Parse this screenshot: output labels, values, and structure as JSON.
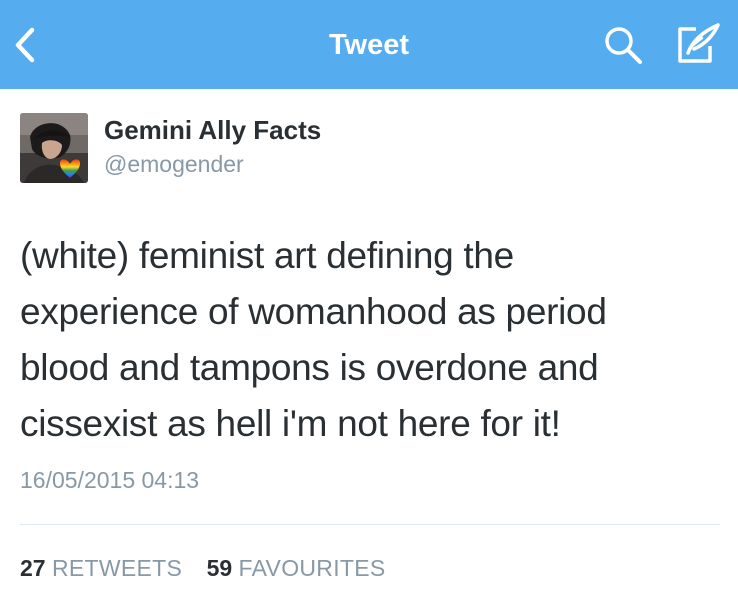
{
  "colors": {
    "nav_background": "#55acee",
    "nav_foreground": "#ffffff",
    "text_primary": "#292f33",
    "text_secondary": "#8899a6",
    "divider": "#e1e8ed"
  },
  "navbar": {
    "title": "Tweet",
    "back_icon": "chevron-left-icon",
    "search_icon": "search-icon",
    "compose_icon": "compose-icon"
  },
  "tweet": {
    "author": {
      "name": "Gemini Ally Facts",
      "handle": "@emogender",
      "avatar_icon": "avatar-photo-with-rainbow-heart"
    },
    "text_lines": [
      "(white) feminist art defining the",
      "experience of womanhood as period",
      "blood and tampons is overdone and",
      "cissexist as hell i'm not here for it!"
    ],
    "timestamp": "16/05/2015 04:13",
    "stats": {
      "retweets_count": "27",
      "retweets_label": "RETWEETS",
      "favourites_count": "59",
      "favourites_label": "FAVOURITES"
    }
  }
}
